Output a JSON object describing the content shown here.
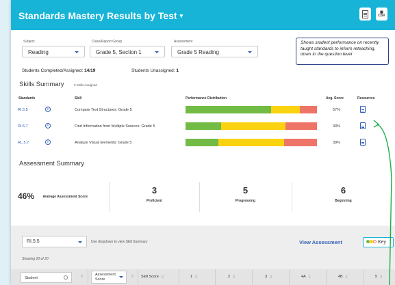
{
  "header": {
    "title": "Standards Mastery Results by Test",
    "caret": "▾",
    "pdf_icon": "pdf-icon",
    "csv_label": "CSV"
  },
  "callout": {
    "text": "Shows student performance on recently taught standards to inform reteaching, down to the question level"
  },
  "filters": {
    "subject": {
      "label": "Subject",
      "value": "Reading"
    },
    "group": {
      "label": "Class/Report Group",
      "value": "Grade 5, Section 1"
    },
    "assessment": {
      "label": "Assessment",
      "value": "Grade 5 Reading"
    }
  },
  "stats": {
    "completed_label": "Students Completed/Assigned:",
    "completed_value": "14/19",
    "unassigned_label": "Students Unassigned:",
    "unassigned_value": "1"
  },
  "skills": {
    "title": "Skills Summary",
    "assigned": "3 Skills Assigned",
    "headers": {
      "standards": "Standards",
      "skill": "Skill",
      "perf": "Performance Distribution",
      "avg": "Avg. Score",
      "resources": "Resources"
    },
    "rows": [
      {
        "standard": "RI.5.5",
        "skill": "Compare Text Structures: Grade 5",
        "avg": "57%",
        "dist": [
          0.65,
          0.22,
          0.13
        ]
      },
      {
        "standard": "RI.5.7",
        "skill": "Find Information from Multiple Sources: Grade 5",
        "avg": "43%",
        "dist": [
          0.27,
          0.49,
          0.24
        ]
      },
      {
        "standard": "RL.5.7",
        "skill": "Analyze Visual Elements: Grade 5",
        "avg": "39%",
        "dist": [
          0.25,
          0.5,
          0.25
        ]
      }
    ],
    "colors": {
      "proficient": "#72bb45",
      "progressing": "#fbd20f",
      "beginning": "#ef7468"
    }
  },
  "assessment": {
    "title": "Assessment Summary",
    "avg_value": "46%",
    "avg_label": "Average Assessment Score",
    "proficient": {
      "value": "3",
      "label": "Proficient"
    },
    "progressing": {
      "value": "5",
      "label": "Progressing"
    },
    "beginning": {
      "value": "6",
      "label": "Beginning"
    }
  },
  "lower": {
    "dropdown_value": "RI.5.5",
    "hint": "Use dropdown to view Skill Summary",
    "view_link": "View Assessment",
    "key_label": "Key",
    "showing": "Showing 20 of 20",
    "columns": {
      "student": "Student",
      "assessment_score": "Assessment Score",
      "skill_score": "Skill Score",
      "q1": "1",
      "q2": "2",
      "q3": "3",
      "q4a": "4A",
      "q4b": "4B",
      "q5": "5"
    }
  }
}
